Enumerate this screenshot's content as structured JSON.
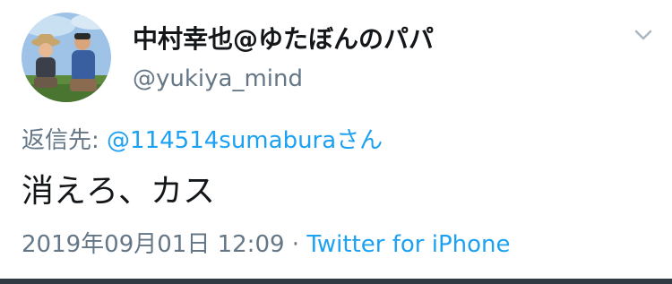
{
  "tweet": {
    "display_name": "中村幸也@ゆたぼんのパパ",
    "handle": "@yukiya_mind",
    "reply_prefix": "返信先:",
    "reply_mention": "@114514sumabura",
    "reply_suffix": "さん",
    "text": "消えろ、カス",
    "timestamp": "2019年09月01日 12:09",
    "separator": "·",
    "source": "Twitter for iPhone"
  },
  "icons": {
    "menu": "chevron-down-icon"
  },
  "colors": {
    "link": "#1da1f2",
    "secondary": "#657786",
    "primary": "#14171a",
    "divider": "#2f3a43"
  }
}
